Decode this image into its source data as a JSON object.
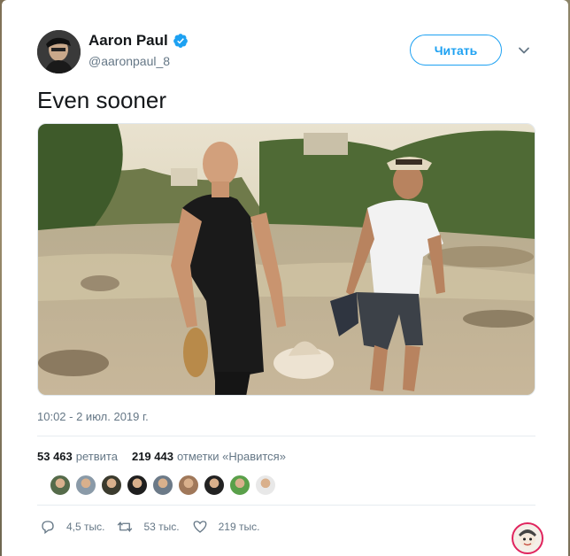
{
  "author": {
    "display_name": "Aaron Paul",
    "handle": "@aaronpaul_8",
    "avatar_icon": "avatar-photo",
    "verified_icon": "verified-badge-icon"
  },
  "follow_button": {
    "label": "Читать"
  },
  "tweet": {
    "text": "Even sooner",
    "photo_icon": "photo-two-men-walking-in-river",
    "timestamp": "10:02 - 2 июл. 2019 г."
  },
  "stats": {
    "retweets_count": "53 463",
    "retweets_label": "ретвита",
    "likes_count": "219 443",
    "likes_label": "отметки «Нравится»"
  },
  "liker_avatars": [
    {
      "color": "#556b4a"
    },
    {
      "color": "#8a9aa8"
    },
    {
      "color": "#3b3b2e"
    },
    {
      "color": "#1f1f1f"
    },
    {
      "color": "#6c7a88"
    },
    {
      "color": "#a0785a"
    },
    {
      "color": "#222222"
    },
    {
      "color": "#5aa04a"
    },
    {
      "color": "#e8e8e8"
    }
  ],
  "actions": {
    "reply_count": "4,5 тыс.",
    "retweet_count": "53 тыс.",
    "like_count": "219 тыс."
  },
  "colors": {
    "accent": "#1da1f2",
    "text_primary": "#14171a",
    "text_secondary": "#657786"
  }
}
